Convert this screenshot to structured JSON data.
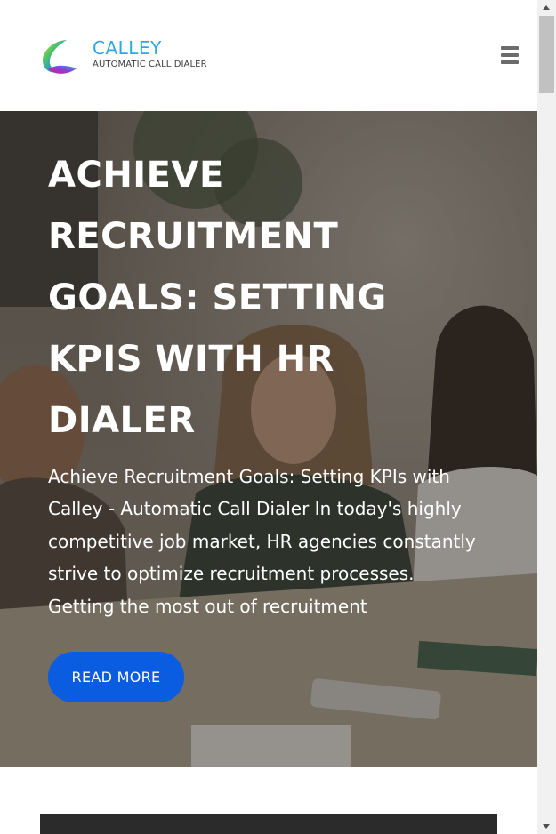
{
  "header": {
    "brand_name": "CALLEY",
    "brand_tagline": "AUTOMATIC CALL DIALER",
    "menu_icon": "hamburger-menu-icon"
  },
  "hero": {
    "title_lines": [
      "ACHIEVE",
      "RECRUITMENT",
      "GOALS: SETTING",
      "KPIS WITH HR",
      "DIALER"
    ],
    "excerpt_lines": [
      "Achieve Recruitment Goals: Setting KPIs with",
      "Calley - Automatic Call Dialer In today's highly",
      "competitive job market, HR agencies constantly",
      "strive to optimize recruitment processes.",
      "Getting the most out of recruitment"
    ],
    "button_label": "READ MORE"
  },
  "colors": {
    "brand_blue": "#2ea7e0",
    "button_blue": "#0a5ce0",
    "menu_gray": "#6b6b6b"
  }
}
